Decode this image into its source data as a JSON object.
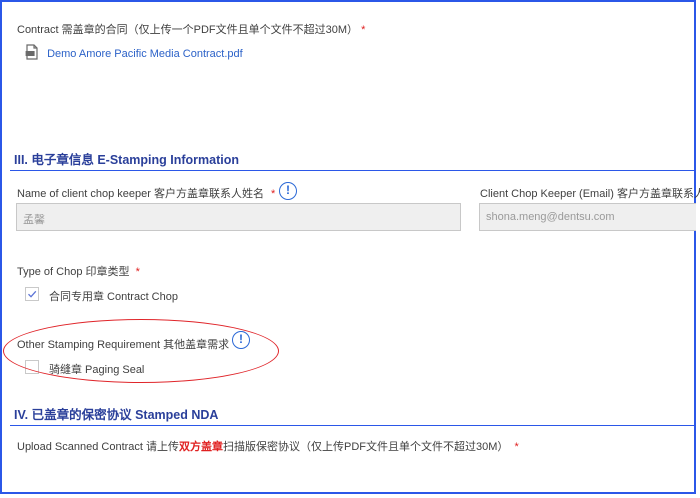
{
  "contract": {
    "label": "Contract 需盖章的合同（仅上传一个PDF文件且单个文件不超过30M）",
    "required_mark": "*",
    "file_name": "Demo Amore Pacific Media Contract.pdf",
    "file_icon": "pdf-file-icon"
  },
  "section3": {
    "title": "III. 电子章信息 E-Stamping Information",
    "client_chop_keeper_name": {
      "label": "Name of client chop keeper 客户方盖章联系人姓名",
      "required_mark": "*",
      "value": "孟馨"
    },
    "client_chop_keeper_email": {
      "label": "Client Chop Keeper (Email) 客户方盖章联系人",
      "value": "shona.meng@dentsu.com"
    },
    "type_of_chop": {
      "label": "Type of Chop 印章类型",
      "required_mark": "*",
      "option_label": "合同专用章 Contract Chop",
      "checked": true
    },
    "other_stamping": {
      "label": "Other Stamping Requirement 其他盖章需求",
      "option_label": "骑缝章 Paging Seal",
      "checked": false
    },
    "info_glyph": "!"
  },
  "section4": {
    "title": "IV. 已盖章的保密协议 Stamped NDA",
    "upload_label_prefix": "Upload Scanned Contract 请上传",
    "upload_label_highlight": "双方盖章",
    "upload_label_suffix": "扫描版保密协议（仅上传PDF文件且单个文件不超过30M）",
    "required_mark": "*"
  },
  "colors": {
    "frame": "#2b57e8",
    "section_title": "#2a3f9a",
    "required": "#e02020",
    "link": "#2c62c8",
    "annotation_circle": "#e0262b"
  }
}
